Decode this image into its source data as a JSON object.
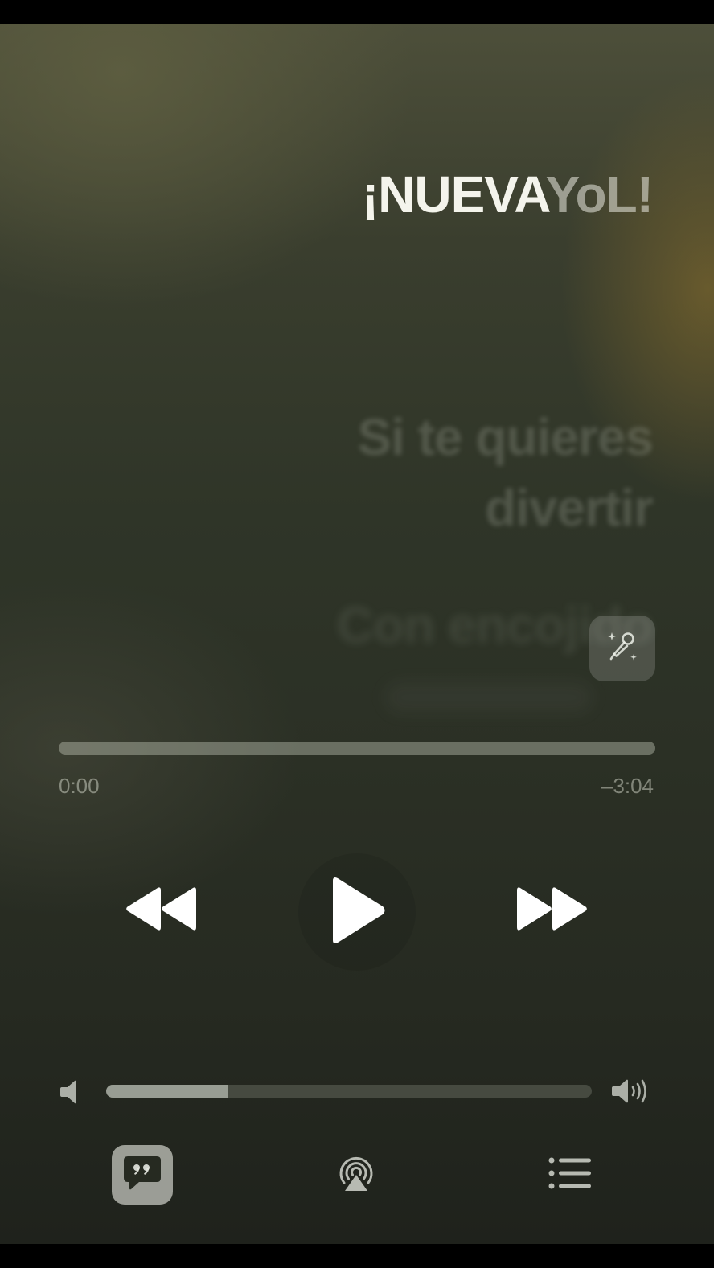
{
  "lyrics": {
    "current_sung": "¡NUEVA",
    "current_unsung": "YoL!",
    "next": "Si te quieres divertir",
    "after": "Con encojido"
  },
  "playback": {
    "elapsed": "0:00",
    "remaining": "–3:04",
    "progress_fraction": 0.0
  },
  "volume": {
    "level_fraction": 0.25
  },
  "icons": {
    "sing": "microphone-sparkles-icon",
    "rewind": "rewind-icon",
    "play": "play-icon",
    "forward": "fast-forward-icon",
    "volume_low": "speaker-low-icon",
    "volume_high": "speaker-high-icon",
    "lyrics": "lyrics-quote-bubble-icon",
    "airplay": "airplay-icon",
    "queue": "queue-list-icon"
  },
  "colors": {
    "lyric_active": "#f4f4ec",
    "accent_gold": "#78642d"
  }
}
